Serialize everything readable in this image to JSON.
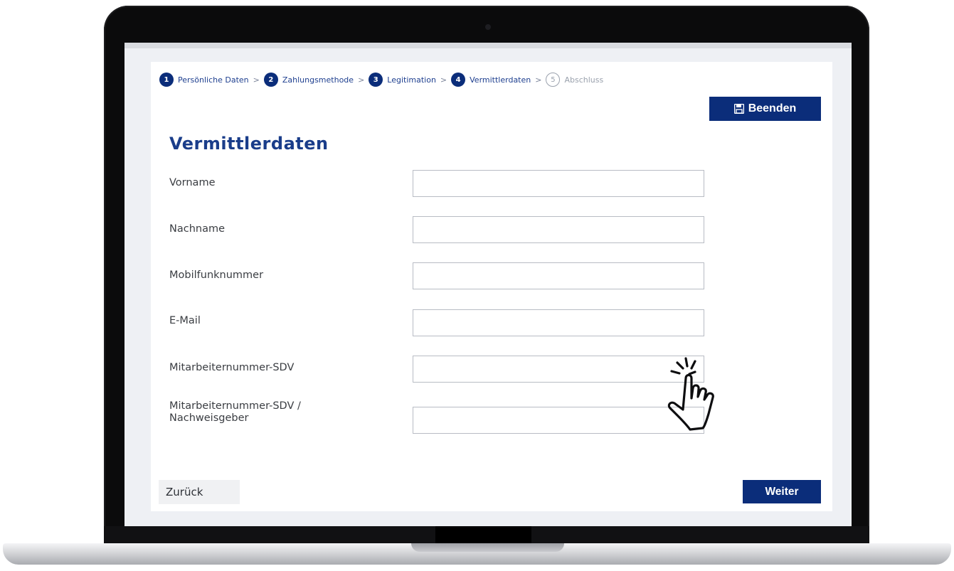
{
  "stepper": {
    "steps": [
      {
        "num": "1",
        "label": "Persönliche Daten"
      },
      {
        "num": "2",
        "label": "Zahlungsmethode"
      },
      {
        "num": "3",
        "label": "Legitimation"
      },
      {
        "num": "4",
        "label": "Vermittlerdaten"
      },
      {
        "num": "5",
        "label": "Abschluss"
      }
    ],
    "separator": ">"
  },
  "header": {
    "beenden_label": "Beenden",
    "beenden_icon": "save-icon"
  },
  "page": {
    "title": "Vermittlerdaten"
  },
  "form": {
    "fields": [
      {
        "label": "Vorname",
        "value": ""
      },
      {
        "label": "Nachname",
        "value": ""
      },
      {
        "label": "Mobilfunknummer",
        "value": ""
      },
      {
        "label": "E-Mail",
        "value": ""
      },
      {
        "label": "Mitarbeiternummer-SDV",
        "value": ""
      },
      {
        "label": "Mitarbeiternummer-SDV /",
        "label_line2": "Nachweisgeber",
        "value": ""
      }
    ]
  },
  "footer": {
    "back_label": "Zurück",
    "next_label": "Weiter"
  },
  "colors": {
    "primary": "#0b2d7a",
    "title": "#1a3d8a",
    "inactive": "#9aa1ad"
  },
  "cursor": {
    "icon": "hand-pointer-icon"
  }
}
